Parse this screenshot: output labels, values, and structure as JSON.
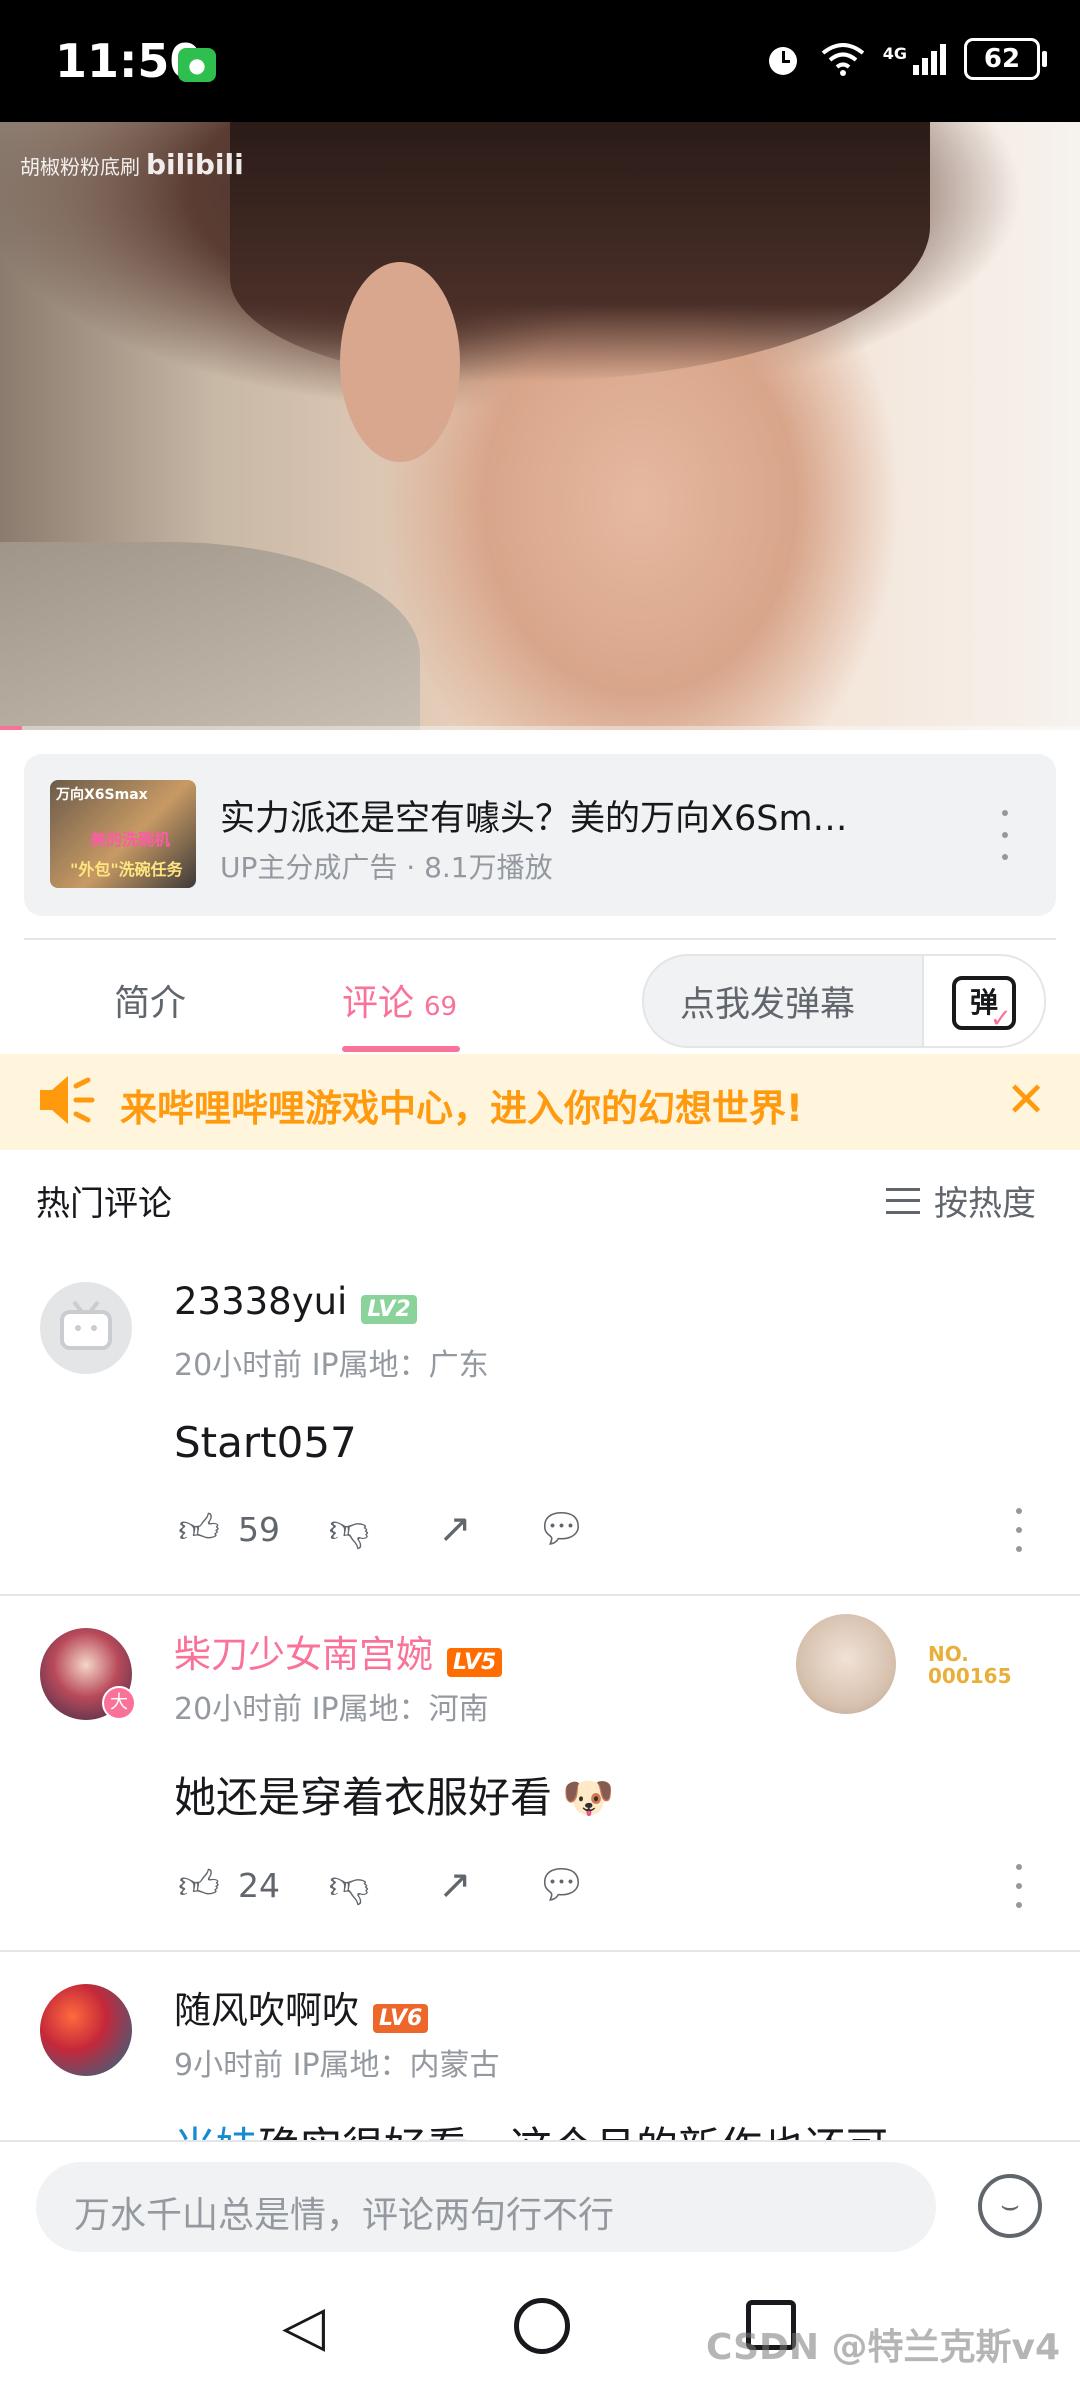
{
  "status_bar": {
    "time": "11:50",
    "app_icon": "wechat-icon",
    "icons": [
      "alarm-icon",
      "wifi-icon",
      "4g-signal-icon"
    ],
    "network": "4G",
    "battery": "62"
  },
  "video": {
    "watermark": "胡椒粉粉底刷",
    "brand": "bilibili",
    "progress": 0.02
  },
  "ad_card": {
    "thumb_top": "万向X6Smax",
    "thumb_mid": "美的洗碗机",
    "thumb_bottom": "\"外包\"洗碗任务",
    "title": "实力派还是空有噱头？美的万向X6Sm…",
    "meta": "UP主分成广告 · 8.1万播放"
  },
  "tabs": {
    "intro": "简介",
    "comments": "评论",
    "comments_count": "69",
    "danmaku_placeholder": "点我发弹幕",
    "danmaku_btn": "弹"
  },
  "notice": {
    "text": "来哔哩哔哩游戏中心，进入你的幻想世界!"
  },
  "section": {
    "title": "热门评论",
    "sort": "按热度"
  },
  "comments": [
    {
      "user": "23338yui",
      "level": "LV2",
      "meta": "20小时前  IP属地：广东",
      "text": "Start057",
      "likes": "59"
    },
    {
      "user": "柴刀少女南宫婉",
      "level": "LV5",
      "meta": "20小时前  IP属地：河南",
      "text": "她还是穿着衣服好看",
      "emoji": "🐶",
      "likes": "24",
      "pendant_no": "NO.\n000165"
    },
    {
      "user": "随风吹啊吹",
      "level": "LV6",
      "meta": "9小时前  IP属地：内蒙古",
      "text_link": "米娃",
      "text": "确实很好看，这个月的新作也还可"
    }
  ],
  "input": {
    "placeholder": "万水千山总是情，评论两句行不行"
  },
  "nav": {
    "watermark": "CSDN @特兰克斯v4"
  },
  "colors": {
    "accent": "#fb7299",
    "notice": "#ff9a0e",
    "lv2": "#8bd29b",
    "lv5": "#ff6c00",
    "lv6": "#ee672a"
  }
}
